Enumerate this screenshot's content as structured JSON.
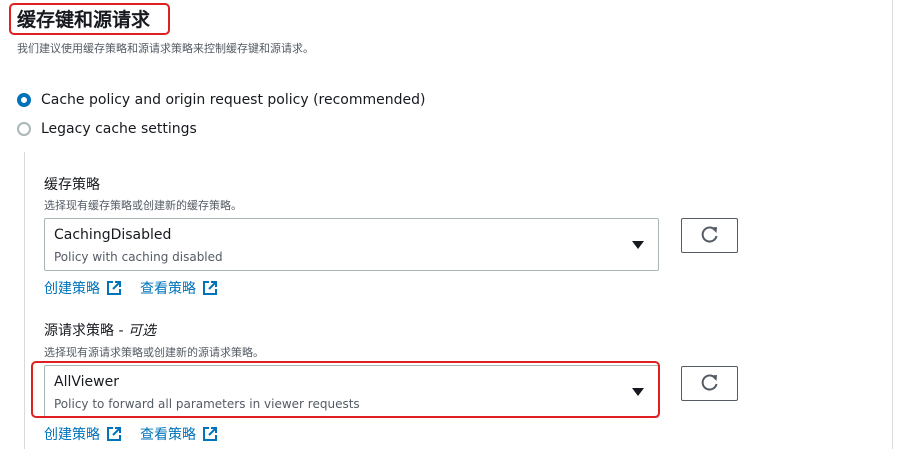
{
  "section": {
    "title": "缓存键和源请求",
    "subtitle": "我们建议使用缓存策略和源请求策略来控制缓存键和源请求。"
  },
  "radios": [
    {
      "label": "Cache policy and origin request policy (recommended)",
      "checked": true
    },
    {
      "label": "Legacy cache settings",
      "checked": false
    }
  ],
  "cache_policy": {
    "label": "缓存策略",
    "description": "选择现有缓存策略或创建新的缓存策略。",
    "selected_value": "CachingDisabled",
    "selected_description": "Policy with caching disabled",
    "create_link": "创建策略",
    "view_link": "查看策略"
  },
  "origin_request_policy": {
    "label": "源请求策略",
    "optional_suffix": " - 可选",
    "description": "选择现有源请求策略或创建新的源请求策略。",
    "selected_value": "AllViewer",
    "selected_description": "Policy to forward all parameters in viewer requests",
    "create_link": "创建策略",
    "view_link": "查看策略"
  },
  "colors": {
    "accent": "#0073bb",
    "highlight": "#e02020",
    "text": "#16191f",
    "muted": "#545b64"
  },
  "icons": [
    "refresh-icon",
    "external-link-icon",
    "caret-down-icon"
  ]
}
